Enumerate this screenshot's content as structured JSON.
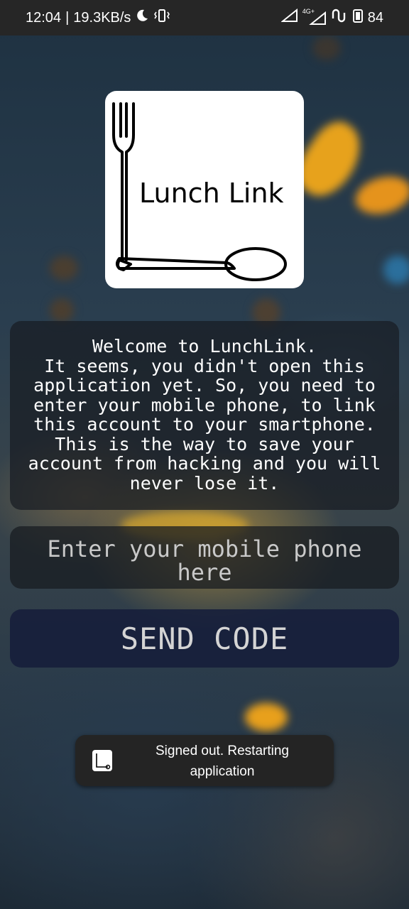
{
  "status_bar": {
    "time": "12:04",
    "separator": "|",
    "net_speed": "19.3KB/s",
    "network_label": "4G+",
    "battery_level": "84",
    "icons": [
      "moon-icon",
      "vibrate-icon",
      "signal-icon",
      "signal-4g-icon",
      "sync-icon",
      "battery-icon"
    ]
  },
  "logo": {
    "text": "Lunch Link",
    "icons": [
      "fork-icon",
      "spoon-icon"
    ]
  },
  "welcome": {
    "lines": [
      "Welcome to LunchLink.",
      "It seems, you didn't open this",
      "application yet. So, you need to",
      "enter your mobile phone, to link",
      "this account to your smartphone.",
      "This is the way to save your",
      "account from hacking and you will",
      "never lose it."
    ]
  },
  "phone_input": {
    "placeholder": "Enter your mobile phone here",
    "value": ""
  },
  "send_button": {
    "label": "SEND CODE"
  },
  "toast": {
    "text": "Signed out. Restarting application",
    "icon": "app-icon"
  },
  "colors": {
    "card_bg": "#181c22",
    "button_bg": "#161e3a",
    "text": "#ffffff",
    "placeholder": "#c9c9c9"
  }
}
